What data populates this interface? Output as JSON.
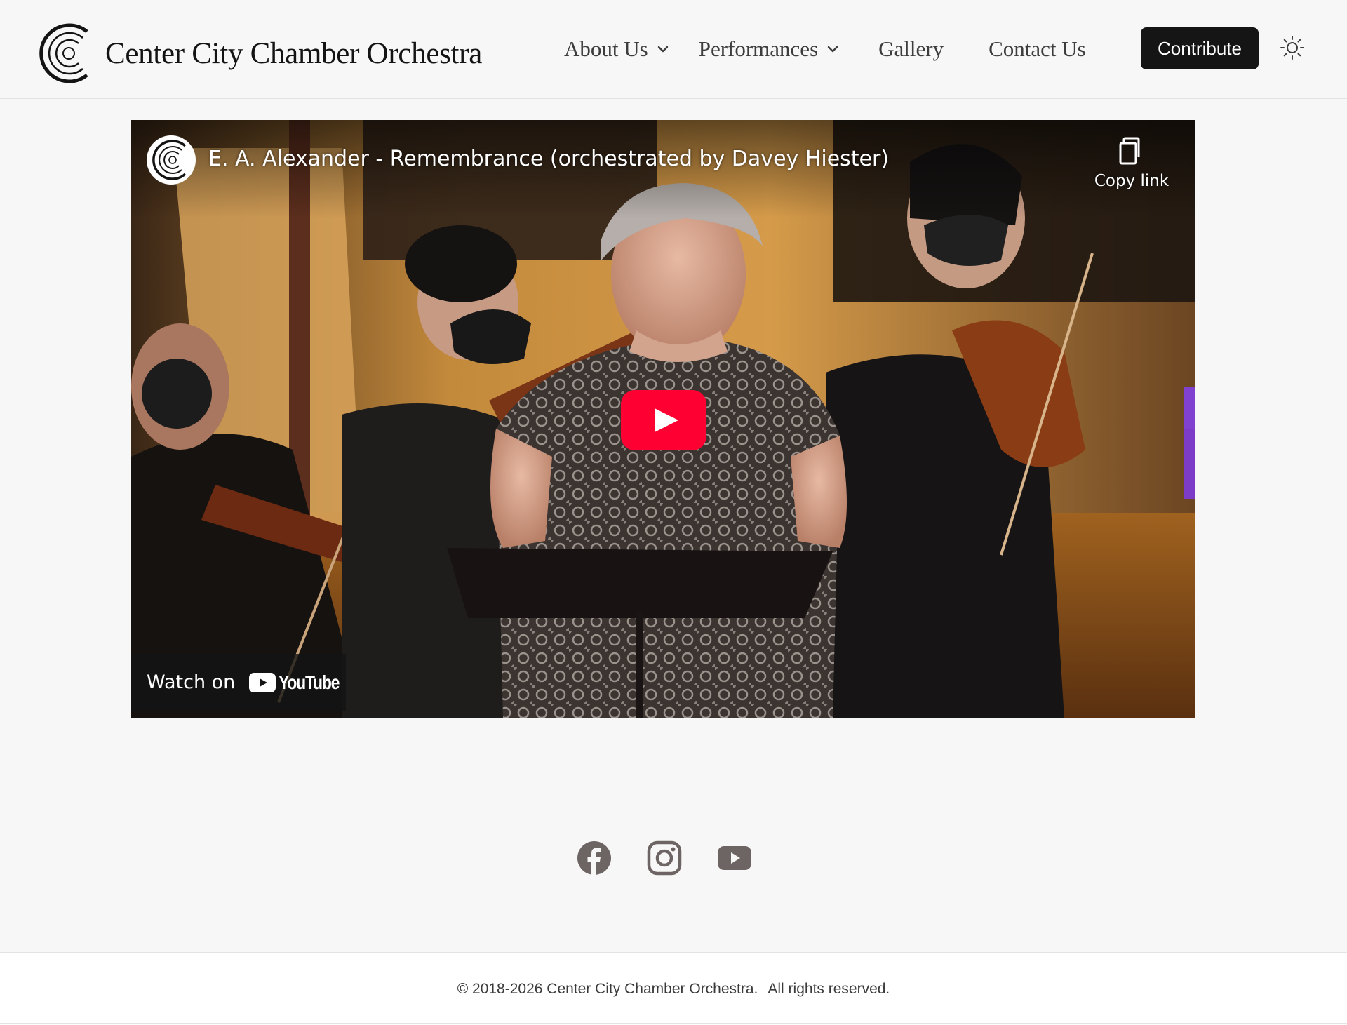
{
  "header": {
    "site_name": "Center City Chamber Orchestra",
    "nav": {
      "about_label": "About Us",
      "performances_label": "Performances",
      "gallery_label": "Gallery",
      "contact_label": "Contact Us"
    },
    "contribute_label": "Contribute",
    "theme_toggle_icon": "sun-icon"
  },
  "video": {
    "title": "E. A. Alexander - Remembrance (orchestrated by Davey Hiester)",
    "copy_link_label": "Copy link",
    "watch_on_label": "Watch on",
    "youtube_wordmark": "YouTube",
    "play_icon": "youtube-play-icon",
    "play_color": "#ff0033"
  },
  "social": {
    "icons": [
      "facebook-icon",
      "instagram-icon",
      "youtube-icon"
    ],
    "icon_color": "#6d6563"
  },
  "footer": {
    "copyright": "© 2018-2026 Center City Chamber Orchestra.",
    "rights": "All rights reserved."
  },
  "colors": {
    "page_background": "#f8f7f7",
    "button_background": "#161515",
    "text_primary": "#141414"
  }
}
